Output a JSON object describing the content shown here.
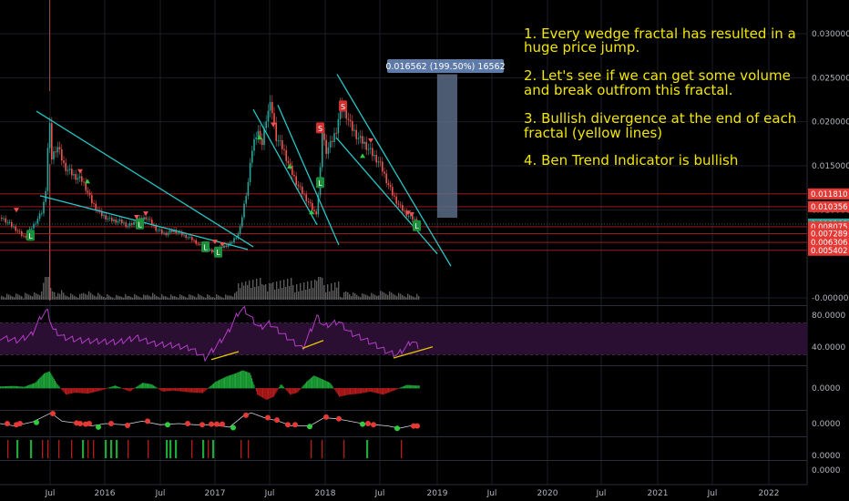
{
  "colors": {
    "background": "#000000",
    "grid": "#1c1e26",
    "axis_text": "#b2b5be",
    "candle_up": "#26a69a",
    "candle_down": "#ef5350",
    "trendline": "#26c6c6",
    "resistance": "#b71c1c",
    "annotation": "#f2e600",
    "rsi_line": "#b43cc8",
    "rsi_band": "#2a0f33",
    "divergence": "#e6c600",
    "current_price_tag": "#26a69a",
    "level_tag": "#e53935",
    "measure_box": "#5b6b86",
    "volume": "#8c8c8c"
  },
  "annotations": [
    "1. Every wedge fractal has resulted in a",
    "huge price jump.",
    "2. Let's see if we can get some volume",
    "and break outfrom this fractal.",
    "3. Bullish divergence at the end of each",
    "fractal (yellow lines)",
    "4. Ben Trend Indicator is bullish"
  ],
  "measure_label": "0.016562 (199.50%) 16562",
  "chart_data": [
    {
      "type": "candlestick",
      "title": "",
      "x_ticks": [
        "Jul",
        "2016",
        "Jul",
        "2017",
        "Jul",
        "2018",
        "Jul",
        "2019",
        "Jul",
        "2020",
        "Jul",
        "2021",
        "Jul",
        "2022"
      ],
      "y_ticks": [
        "0.030000",
        "0.025000",
        "0.020000",
        "0.015000",
        "0.010000",
        "-0.000000"
      ],
      "ylim": [
        -0.001,
        0.034
      ],
      "y_tick_values": [
        0.03,
        0.025,
        0.02,
        0.015,
        0.01,
        0.0
      ],
      "price_tags": [
        {
          "label": "0.011810",
          "value": 0.01181,
          "kind": "level"
        },
        {
          "label": "0.010356",
          "value": 0.010356,
          "kind": "level"
        },
        {
          "label": "0.008388",
          "value": 0.008388,
          "kind": "current"
        },
        {
          "label": "0.008075",
          "value": 0.008075,
          "kind": "level"
        },
        {
          "label": "0.007289",
          "value": 0.007289,
          "kind": "level"
        },
        {
          "label": "0.006306",
          "value": 0.006306,
          "kind": "level"
        },
        {
          "label": "0.005402",
          "value": 0.005402,
          "kind": "level"
        }
      ],
      "price_series_approx": [
        [
          0,
          0.0091
        ],
        [
          8,
          0.0085
        ],
        [
          16,
          0.0078
        ],
        [
          26,
          0.0068
        ],
        [
          36,
          0.0082
        ],
        [
          46,
          0.0098
        ],
        [
          50,
          0.0128
        ],
        [
          53,
          0.0205
        ],
        [
          56,
          0.0158
        ],
        [
          62,
          0.0172
        ],
        [
          70,
          0.0148
        ],
        [
          80,
          0.0138
        ],
        [
          90,
          0.0132
        ],
        [
          100,
          0.0108
        ],
        [
          110,
          0.0094
        ],
        [
          120,
          0.0088
        ],
        [
          132,
          0.0086
        ],
        [
          140,
          0.0081
        ],
        [
          150,
          0.0087
        ],
        [
          160,
          0.0091
        ],
        [
          170,
          0.0078
        ],
        [
          180,
          0.0072
        ],
        [
          190,
          0.0076
        ],
        [
          200,
          0.0071
        ],
        [
          210,
          0.0066
        ],
        [
          220,
          0.0058
        ],
        [
          232,
          0.0052
        ],
        [
          240,
          0.0056
        ],
        [
          252,
          0.0061
        ],
        [
          262,
          0.0074
        ],
        [
          266,
          0.0098
        ],
        [
          272,
          0.0133
        ],
        [
          276,
          0.0168
        ],
        [
          282,
          0.0192
        ],
        [
          286,
          0.0168
        ],
        [
          292,
          0.0208
        ],
        [
          297,
          0.0218
        ],
        [
          302,
          0.0182
        ],
        [
          310,
          0.0168
        ],
        [
          318,
          0.0145
        ],
        [
          326,
          0.0127
        ],
        [
          334,
          0.0114
        ],
        [
          340,
          0.0104
        ],
        [
          346,
          0.0093
        ],
        [
          350,
          0.0128
        ],
        [
          353,
          0.0188
        ],
        [
          357,
          0.0166
        ],
        [
          362,
          0.0173
        ],
        [
          368,
          0.0188
        ],
        [
          373,
          0.0214
        ],
        [
          378,
          0.0211
        ],
        [
          384,
          0.0194
        ],
        [
          392,
          0.0181
        ],
        [
          400,
          0.0173
        ],
        [
          408,
          0.0162
        ],
        [
          416,
          0.0152
        ],
        [
          424,
          0.0131
        ],
        [
          430,
          0.0117
        ],
        [
          436,
          0.0106
        ],
        [
          442,
          0.0098
        ],
        [
          448,
          0.0092
        ],
        [
          454,
          0.0088
        ],
        [
          459,
          0.0084
        ]
      ],
      "signals": [
        {
          "x": 33,
          "value": 0.0071,
          "label": "L"
        },
        {
          "x": 153,
          "value": 0.0084,
          "label": "L"
        },
        {
          "x": 225,
          "value": 0.0058,
          "label": "L"
        },
        {
          "x": 239,
          "value": 0.0052,
          "label": "L"
        },
        {
          "x": 351,
          "value": 0.0131,
          "label": "L"
        },
        {
          "x": 457,
          "value": 0.0082,
          "label": "L"
        },
        {
          "x": 351,
          "value": 0.0193,
          "label": "S"
        },
        {
          "x": 376,
          "value": 0.0218,
          "label": "S"
        }
      ],
      "wedge_lines": [
        {
          "from": [
            40,
            0.0212
          ],
          "to": [
            278,
            0.0058
          ]
        },
        {
          "from": [
            44,
            0.0116
          ],
          "to": [
            272,
            0.0055
          ]
        },
        {
          "from": [
            305,
            0.0219
          ],
          "to": [
            372,
            0.006
          ]
        },
        {
          "from": [
            278,
            0.0214
          ],
          "to": [
            348,
            0.0083
          ]
        },
        {
          "from": [
            370,
            0.0254
          ],
          "to": [
            495,
            0.0036
          ]
        },
        {
          "from": [
            369,
            0.0182
          ],
          "to": [
            480,
            0.005
          ]
        }
      ],
      "measure": {
        "x_from": 480,
        "x_to": 502,
        "from": 0.0091,
        "to": 0.0254
      }
    },
    {
      "type": "line",
      "title": "",
      "name": "RSI",
      "y_ticks": [
        "80.0000",
        "40.0000"
      ],
      "y_tick_values": [
        80,
        40
      ],
      "ylim": [
        18,
        90
      ],
      "band": [
        30,
        70
      ],
      "values_approx": [
        [
          0,
          52
        ],
        [
          20,
          48
        ],
        [
          35,
          56
        ],
        [
          45,
          78
        ],
        [
          52,
          86
        ],
        [
          58,
          62
        ],
        [
          70,
          52
        ],
        [
          90,
          48
        ],
        [
          110,
          47
        ],
        [
          130,
          46
        ],
        [
          150,
          52
        ],
        [
          170,
          44
        ],
        [
          190,
          42
        ],
        [
          210,
          38
        ],
        [
          225,
          26
        ],
        [
          235,
          38
        ],
        [
          250,
          58
        ],
        [
          262,
          84
        ],
        [
          268,
          88
        ],
        [
          276,
          76
        ],
        [
          285,
          64
        ],
        [
          296,
          70
        ],
        [
          306,
          60
        ],
        [
          320,
          48
        ],
        [
          332,
          38
        ],
        [
          348,
          78
        ],
        [
          356,
          66
        ],
        [
          372,
          72
        ],
        [
          384,
          58
        ],
        [
          396,
          52
        ],
        [
          410,
          44
        ],
        [
          425,
          34
        ],
        [
          436,
          30
        ],
        [
          446,
          40
        ],
        [
          452,
          48
        ],
        [
          460,
          40
        ]
      ],
      "divergence_lines": [
        {
          "from": [
            232,
            24
          ],
          "to": [
            262,
            34
          ]
        },
        {
          "from": [
            332,
            38
          ],
          "to": [
            355,
            48
          ]
        },
        {
          "from": [
            432,
            26
          ],
          "to": [
            475,
            40
          ]
        }
      ]
    },
    {
      "type": "bar",
      "title": "",
      "name": "Histogram",
      "y_ticks": [
        "0.0000"
      ],
      "y_tick_values": [
        0
      ],
      "ylim": [
        -1,
        1
      ],
      "values_approx": [
        [
          2,
          0.08
        ],
        [
          14,
          0.1
        ],
        [
          26,
          0.06
        ],
        [
          38,
          0.25
        ],
        [
          48,
          0.7
        ],
        [
          54,
          0.8
        ],
        [
          62,
          0.2
        ],
        [
          72,
          -0.3
        ],
        [
          82,
          -0.2
        ],
        [
          96,
          -0.25
        ],
        [
          110,
          -0.1
        ],
        [
          126,
          0.12
        ],
        [
          142,
          -0.15
        ],
        [
          156,
          0.25
        ],
        [
          166,
          0.18
        ],
        [
          178,
          -0.15
        ],
        [
          190,
          -0.1
        ],
        [
          206,
          -0.18
        ],
        [
          222,
          -0.22
        ],
        [
          236,
          0.3
        ],
        [
          248,
          0.55
        ],
        [
          258,
          0.7
        ],
        [
          266,
          0.85
        ],
        [
          274,
          0.72
        ],
        [
          282,
          -0.3
        ],
        [
          292,
          -0.55
        ],
        [
          300,
          -0.4
        ],
        [
          308,
          0.2
        ],
        [
          318,
          -0.3
        ],
        [
          326,
          -0.2
        ],
        [
          336,
          0.3
        ],
        [
          344,
          0.6
        ],
        [
          352,
          0.45
        ],
        [
          362,
          0.25
        ],
        [
          372,
          -0.4
        ],
        [
          382,
          -0.3
        ],
        [
          394,
          -0.25
        ],
        [
          406,
          -0.15
        ],
        [
          420,
          -0.3
        ],
        [
          432,
          -0.1
        ],
        [
          446,
          0.15
        ],
        [
          456,
          0.12
        ]
      ]
    },
    {
      "type": "scatter",
      "title": "",
      "name": "Ben Trend Indicator",
      "y_ticks": [
        "0.0000"
      ],
      "y_tick_values": [
        0
      ],
      "ylim": [
        -1,
        1
      ],
      "line_approx": [
        [
          0,
          0.0
        ],
        [
          16,
          -0.2
        ],
        [
          36,
          0.15
        ],
        [
          56,
          0.9
        ],
        [
          68,
          0.2
        ],
        [
          84,
          0.05
        ],
        [
          100,
          -0.2
        ],
        [
          116,
          0.0
        ],
        [
          136,
          -0.1
        ],
        [
          156,
          0.2
        ],
        [
          176,
          -0.1
        ],
        [
          196,
          0.0
        ],
        [
          214,
          -0.1
        ],
        [
          234,
          -0.1
        ],
        [
          252,
          -0.3
        ],
        [
          268,
          0.7
        ],
        [
          276,
          0.9
        ],
        [
          290,
          0.5
        ],
        [
          306,
          0.2
        ],
        [
          320,
          -0.2
        ],
        [
          340,
          -0.2
        ],
        [
          356,
          0.5
        ],
        [
          370,
          0.4
        ],
        [
          384,
          0.2
        ],
        [
          398,
          0.0
        ],
        [
          412,
          -0.1
        ],
        [
          426,
          -0.2
        ],
        [
          438,
          -0.4
        ],
        [
          450,
          -0.2
        ],
        [
          460,
          -0.2
        ]
      ],
      "points_approx": [
        {
          "x": 8,
          "value": 0.0,
          "signal": "sell"
        },
        {
          "x": 18,
          "value": -0.1,
          "signal": "sell"
        },
        {
          "x": 22,
          "value": 0.0,
          "signal": "sell"
        },
        {
          "x": 40,
          "value": 0.1,
          "signal": "buy"
        },
        {
          "x": 58,
          "value": 0.85,
          "signal": "sell"
        },
        {
          "x": 84,
          "value": 0.05,
          "signal": "sell"
        },
        {
          "x": 88,
          "value": 0.0,
          "signal": "sell"
        },
        {
          "x": 94,
          "value": -0.05,
          "signal": "sell"
        },
        {
          "x": 98,
          "value": 0.0,
          "signal": "sell"
        },
        {
          "x": 108,
          "value": -0.3,
          "signal": "buy"
        },
        {
          "x": 122,
          "value": 0.0,
          "signal": "sell"
        },
        {
          "x": 140,
          "value": -0.15,
          "signal": "sell"
        },
        {
          "x": 162,
          "value": 0.2,
          "signal": "sell"
        },
        {
          "x": 184,
          "value": -0.1,
          "signal": "buy"
        },
        {
          "x": 206,
          "value": 0.0,
          "signal": "sell"
        },
        {
          "x": 222,
          "value": -0.1,
          "signal": "sell"
        },
        {
          "x": 232,
          "value": -0.05,
          "signal": "sell"
        },
        {
          "x": 238,
          "value": -0.05,
          "signal": "sell"
        },
        {
          "x": 244,
          "value": -0.05,
          "signal": "sell"
        },
        {
          "x": 256,
          "value": -0.35,
          "signal": "buy"
        },
        {
          "x": 270,
          "value": 0.7,
          "signal": "sell"
        },
        {
          "x": 294,
          "value": 0.5,
          "signal": "sell"
        },
        {
          "x": 304,
          "value": 0.3,
          "signal": "sell"
        },
        {
          "x": 316,
          "value": -0.1,
          "signal": "sell"
        },
        {
          "x": 324,
          "value": -0.1,
          "signal": "sell"
        },
        {
          "x": 340,
          "value": -0.25,
          "signal": "buy"
        },
        {
          "x": 358,
          "value": 0.55,
          "signal": "sell"
        },
        {
          "x": 372,
          "value": 0.4,
          "signal": "sell"
        },
        {
          "x": 398,
          "value": -0.05,
          "signal": "buy"
        },
        {
          "x": 404,
          "value": 0.0,
          "signal": "sell"
        },
        {
          "x": 410,
          "value": -0.1,
          "signal": "sell"
        },
        {
          "x": 436,
          "value": -0.4,
          "signal": "buy"
        },
        {
          "x": 454,
          "value": -0.2,
          "signal": "sell"
        },
        {
          "x": 458,
          "value": -0.2,
          "signal": "sell"
        }
      ]
    },
    {
      "type": "bar",
      "title": "",
      "name": "Signal bars",
      "y_ticks": [
        "0.0000"
      ],
      "y_tick_values": [
        0
      ],
      "bars_approx": [
        {
          "x": 8,
          "signal": "sell"
        },
        {
          "x": 18,
          "signal": "buy"
        },
        {
          "x": 33,
          "signal": "buy"
        },
        {
          "x": 46,
          "signal": "sell"
        },
        {
          "x": 52,
          "signal": "sell"
        },
        {
          "x": 64,
          "signal": "sell"
        },
        {
          "x": 78,
          "signal": "sell"
        },
        {
          "x": 90,
          "signal": "buy"
        },
        {
          "x": 96,
          "signal": "sell"
        },
        {
          "x": 102,
          "signal": "sell"
        },
        {
          "x": 115,
          "signal": "buy"
        },
        {
          "x": 121,
          "signal": "buy"
        },
        {
          "x": 127,
          "signal": "buy"
        },
        {
          "x": 140,
          "signal": "sell"
        },
        {
          "x": 162,
          "signal": "sell"
        },
        {
          "x": 182,
          "signal": "buy"
        },
        {
          "x": 186,
          "signal": "buy"
        },
        {
          "x": 192,
          "signal": "buy"
        },
        {
          "x": 210,
          "signal": "sell"
        },
        {
          "x": 222,
          "signal": "buy"
        },
        {
          "x": 228,
          "signal": "sell"
        },
        {
          "x": 233,
          "signal": "buy"
        },
        {
          "x": 264,
          "signal": "sell"
        },
        {
          "x": 272,
          "signal": "sell"
        },
        {
          "x": 341,
          "signal": "sell"
        },
        {
          "x": 353,
          "signal": "sell"
        },
        {
          "x": 377,
          "signal": "sell"
        },
        {
          "x": 402,
          "signal": "buy"
        },
        {
          "x": 440,
          "signal": "sell"
        }
      ]
    }
  ]
}
